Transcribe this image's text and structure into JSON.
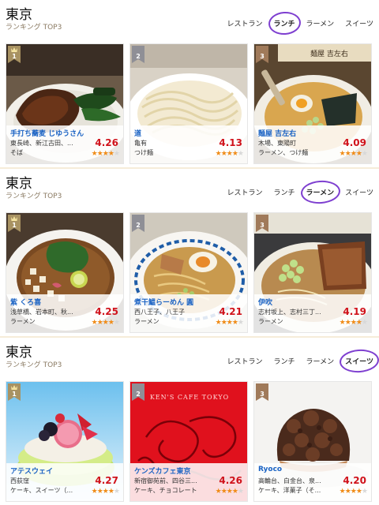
{
  "sections": [
    {
      "city": "東京",
      "ranking_label": "ランキング TOP3",
      "tabs": [
        "レストラン",
        "ランチ",
        "ラーメン",
        "スイーツ"
      ],
      "active_tab": 1,
      "cards": [
        {
          "rank": "1",
          "name": "手打ち蕎麦 じゆうさん",
          "area": "東長崎、新江古田、...",
          "genre": "そば",
          "score": "4.26",
          "stars": 4
        },
        {
          "rank": "2",
          "name": "道",
          "area": "亀有",
          "genre": "つけ麺",
          "score": "4.13",
          "stars": 4
        },
        {
          "rank": "3",
          "name": "麺屋 吉左右",
          "area": "木場、東陽町",
          "genre": "ラーメン、つけ麺",
          "score": "4.09",
          "stars": 4
        }
      ]
    },
    {
      "city": "東京",
      "ranking_label": "ランキング TOP3",
      "tabs": [
        "レストラン",
        "ランチ",
        "ラーメン",
        "スイーツ"
      ],
      "active_tab": 2,
      "cards": [
        {
          "rank": "1",
          "name": "紫 くろ喜",
          "area": "浅草橋、岩本町、秋...",
          "genre": "ラーメン",
          "score": "4.25",
          "stars": 4
        },
        {
          "rank": "2",
          "name": "煮干鰮らーめん 圓",
          "area": "西八王子、八王子",
          "genre": "ラーメン",
          "score": "4.21",
          "stars": 4
        },
        {
          "rank": "3",
          "name": "伊吹",
          "area": "志村坂上、志村三丁...",
          "genre": "ラーメン",
          "score": "4.19",
          "stars": 4
        }
      ]
    },
    {
      "city": "東京",
      "ranking_label": "ランキング TOP3",
      "tabs": [
        "レストラン",
        "ランチ",
        "ラーメン",
        "スイーツ"
      ],
      "active_tab": 3,
      "cards": [
        {
          "rank": "1",
          "name": "アテスウェイ",
          "area": "西荻窪",
          "genre": "ケーキ、スイーツ（...",
          "score": "4.27",
          "stars": 4
        },
        {
          "rank": "2",
          "name": "ケンズカフェ東京",
          "area": "新宿御苑前、四谷三...",
          "genre": "ケーキ、チョコレート",
          "score": "4.26",
          "stars": 4
        },
        {
          "rank": "3",
          "name": "Ryoco",
          "area": "高輪台、白金台、泉...",
          "genre": "ケーキ、洋菓子（そ...",
          "score": "4.20",
          "stars": 4
        }
      ]
    }
  ],
  "photo_texts": {
    "kens_cafe_sign": "KEN'S CAFE TOKYO",
    "kichisou_sign": "麺屋 吉左右"
  },
  "colors": {
    "shop_name": "#1b63c4",
    "score": "#d0121b",
    "star": "#f08c18",
    "active_tab_circle": "#7e3fd0",
    "rank_badge": "#a89262"
  }
}
